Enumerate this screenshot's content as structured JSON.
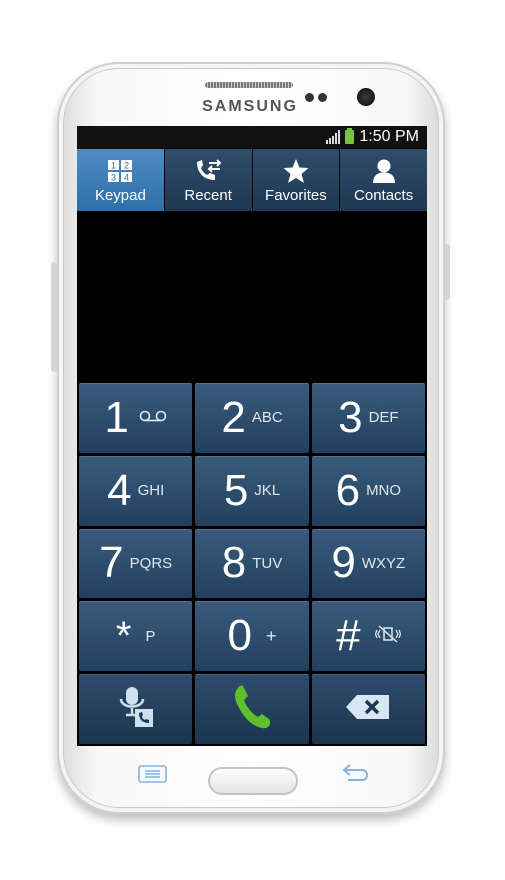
{
  "device": {
    "brand": "SAMSUNG"
  },
  "status_bar": {
    "time": "1:50 PM"
  },
  "tabs": [
    {
      "label": "Keypad",
      "icon": "keypad-grid-icon",
      "active": true
    },
    {
      "label": "Recent",
      "icon": "call-log-icon",
      "active": false
    },
    {
      "label": "Favorites",
      "icon": "star-icon",
      "active": false
    },
    {
      "label": "Contacts",
      "icon": "person-icon",
      "active": false
    }
  ],
  "keypad": {
    "keys": [
      {
        "digit": "1",
        "letters": "",
        "icon": "voicemail-icon"
      },
      {
        "digit": "2",
        "letters": "ABC"
      },
      {
        "digit": "3",
        "letters": "DEF"
      },
      {
        "digit": "4",
        "letters": "GHI"
      },
      {
        "digit": "5",
        "letters": "JKL"
      },
      {
        "digit": "6",
        "letters": "MNO"
      },
      {
        "digit": "7",
        "letters": "PQRS"
      },
      {
        "digit": "8",
        "letters": "TUV"
      },
      {
        "digit": "9",
        "letters": "WXYZ"
      },
      {
        "digit": "*",
        "letters": "P"
      },
      {
        "digit": "0",
        "letters": "+"
      },
      {
        "digit": "#",
        "letters": "",
        "icon": "vibrate-mute-icon"
      }
    ],
    "actions": [
      {
        "icon": "voice-call-icon"
      },
      {
        "icon": "phone-call-icon",
        "color": "#5fbf2a"
      },
      {
        "icon": "backspace-icon"
      }
    ]
  },
  "colors": {
    "tab_active": "#3f7fbf",
    "key_bg": "#2d4b6b",
    "call_green": "#5fbf2a"
  }
}
